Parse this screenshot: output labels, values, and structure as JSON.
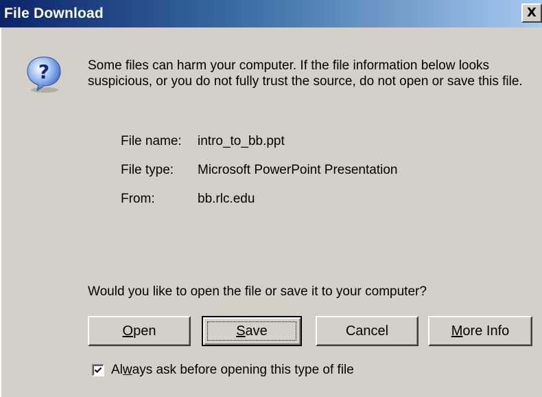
{
  "window": {
    "title": "File Download",
    "close_glyph": "X"
  },
  "dialog": {
    "icon": "question-icon",
    "warning_text": "Some files can harm your computer. If the file information below looks suspicious, or you do not fully trust the source, do not open or save this file.",
    "file_info": {
      "name_label": "File name:",
      "name_value": "intro_to_bb.ppt",
      "type_label": "File type:",
      "type_value": "Microsoft PowerPoint Presentation",
      "from_label": "From:",
      "from_value": "bb.rlc.edu"
    },
    "question_text": "Would you like to open the file or save it to your computer?",
    "buttons": {
      "open": "Open",
      "save": "Save",
      "cancel": "Cancel",
      "more_info_prefix": "",
      "more_info_u": "M",
      "more_info_rest": "ore Info"
    },
    "checkbox": {
      "checked": true,
      "label_prefix": "Al",
      "label_u": "w",
      "label_rest": "ays ask before opening this type of file"
    }
  },
  "colors": {
    "title_gradient_start": "#0a246a",
    "title_gradient_end": "#a6caf0",
    "face": "#d4d0c8"
  }
}
